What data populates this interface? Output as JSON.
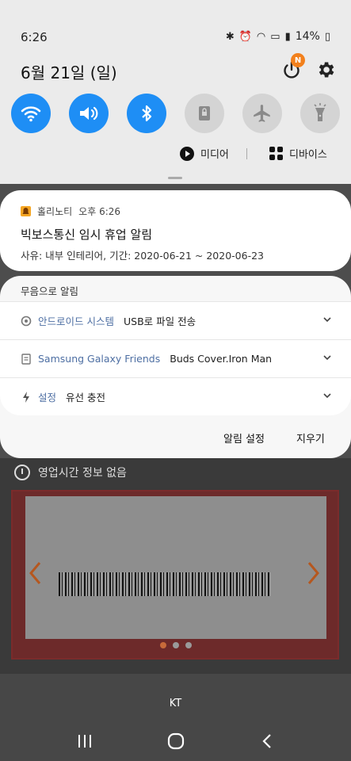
{
  "status_bar": {
    "time": "6:26",
    "battery": "14%"
  },
  "quick_panel": {
    "date": "6월 21일 (일)",
    "power_badge": "N",
    "tiles": [
      {
        "name": "wifi",
        "state": "on"
      },
      {
        "name": "sound",
        "state": "on"
      },
      {
        "name": "bluetooth",
        "state": "on"
      },
      {
        "name": "portrait-lock",
        "state": "off"
      },
      {
        "name": "airplane-mode",
        "state": "off"
      },
      {
        "name": "flashlight",
        "state": "off"
      }
    ],
    "media_label": "미디어",
    "devices_label": "디바이스"
  },
  "notification": {
    "app": "홀리노티",
    "time": "오후 6:26",
    "title": "빅보스통신 임시 휴업 알림",
    "body": "사유: 내부 인테리어, 기간: 2020-06-21 ~ 2020-06-23"
  },
  "silent": {
    "label": "무음으로 알림",
    "items": [
      {
        "app": "안드로이드 시스템",
        "text": "USB로 파일 전송"
      },
      {
        "app": "Samsung Galaxy Friends",
        "text": "Buds Cover.Iron Man"
      },
      {
        "app": "설정",
        "text": "유선 충전"
      }
    ]
  },
  "actions": {
    "settings": "알림 설정",
    "clear": "지우기"
  },
  "background_app": {
    "hours_text": "영업시간 정보 없음"
  },
  "carrier": "KT",
  "colors": {
    "accent": "#1e8ef5",
    "badge": "#f2801c"
  }
}
